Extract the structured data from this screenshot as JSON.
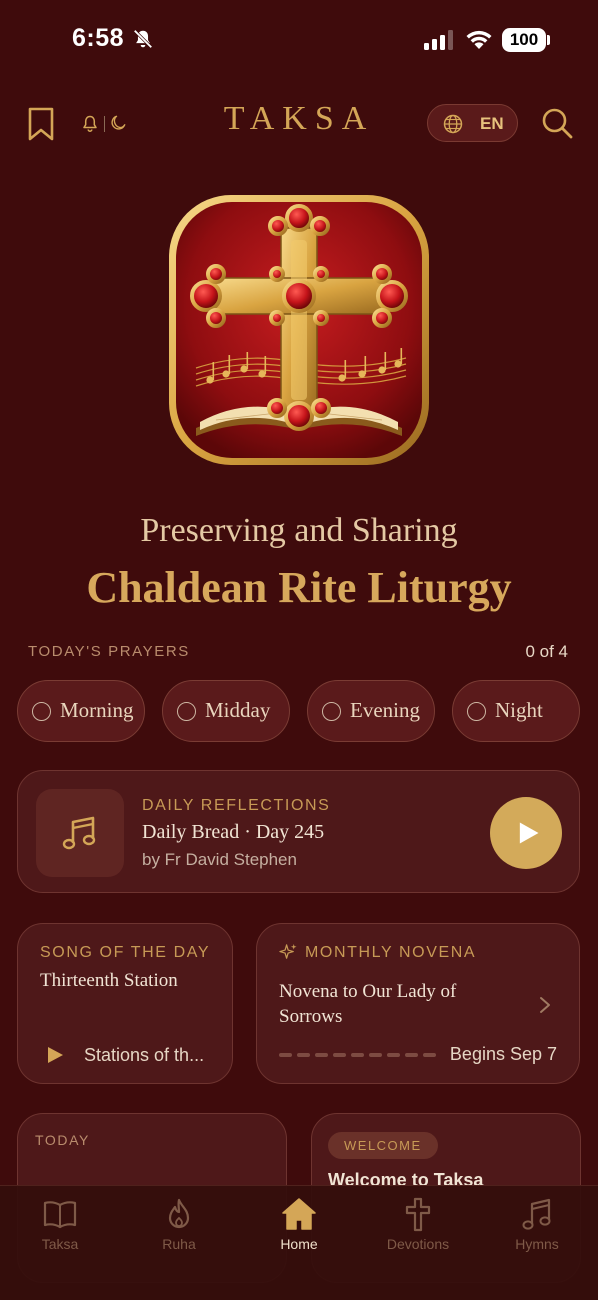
{
  "status_bar": {
    "time": "6:58",
    "battery": "100"
  },
  "header": {
    "title": "TAKSA",
    "language": "EN",
    "icons": [
      "bookmark-icon",
      "bell-icon",
      "moon-icon",
      "globe-icon",
      "search-icon"
    ]
  },
  "hero": {
    "tagline": "Preserving and Sharing",
    "headline": "Chaldean Rite Liturgy"
  },
  "todays_prayers": {
    "label": "TODAY'S PRAYERS",
    "count": "0 of 4",
    "items": [
      {
        "label": "Morning"
      },
      {
        "label": "Midday"
      },
      {
        "label": "Evening"
      },
      {
        "label": "Night"
      }
    ]
  },
  "daily_reflections": {
    "label": "DAILY REFLECTIONS",
    "title": "Daily Bread · Day 245",
    "subtitle": "by Fr David Stephen"
  },
  "song_of_the_day": {
    "label": "SONG OF THE DAY",
    "title": "Thirteenth Station",
    "subtitle": "Stations of th..."
  },
  "monthly_novena": {
    "label": "MONTHLY NOVENA",
    "title": "Novena to Our Lady of Sorrows",
    "status": "Begins Sep 7",
    "progress_days_completed": 0,
    "progress_days_total": 9
  },
  "today_card": {
    "label": "TODAY"
  },
  "welcome_card": {
    "badge": "WELCOME",
    "title": "Welcome to Taksa"
  },
  "tab_bar": {
    "tabs": [
      {
        "label": "Taksa",
        "icon": "book-icon"
      },
      {
        "label": "Ruha",
        "icon": "flame-icon"
      },
      {
        "label": "Home",
        "icon": "home-icon",
        "active": true
      },
      {
        "label": "Devotions",
        "icon": "cross-icon"
      },
      {
        "label": "Hymns",
        "icon": "music-note-icon"
      }
    ]
  },
  "colors": {
    "background": "#3f0b0c",
    "accent_gold": "#d4a657",
    "card": "#4e1819"
  }
}
